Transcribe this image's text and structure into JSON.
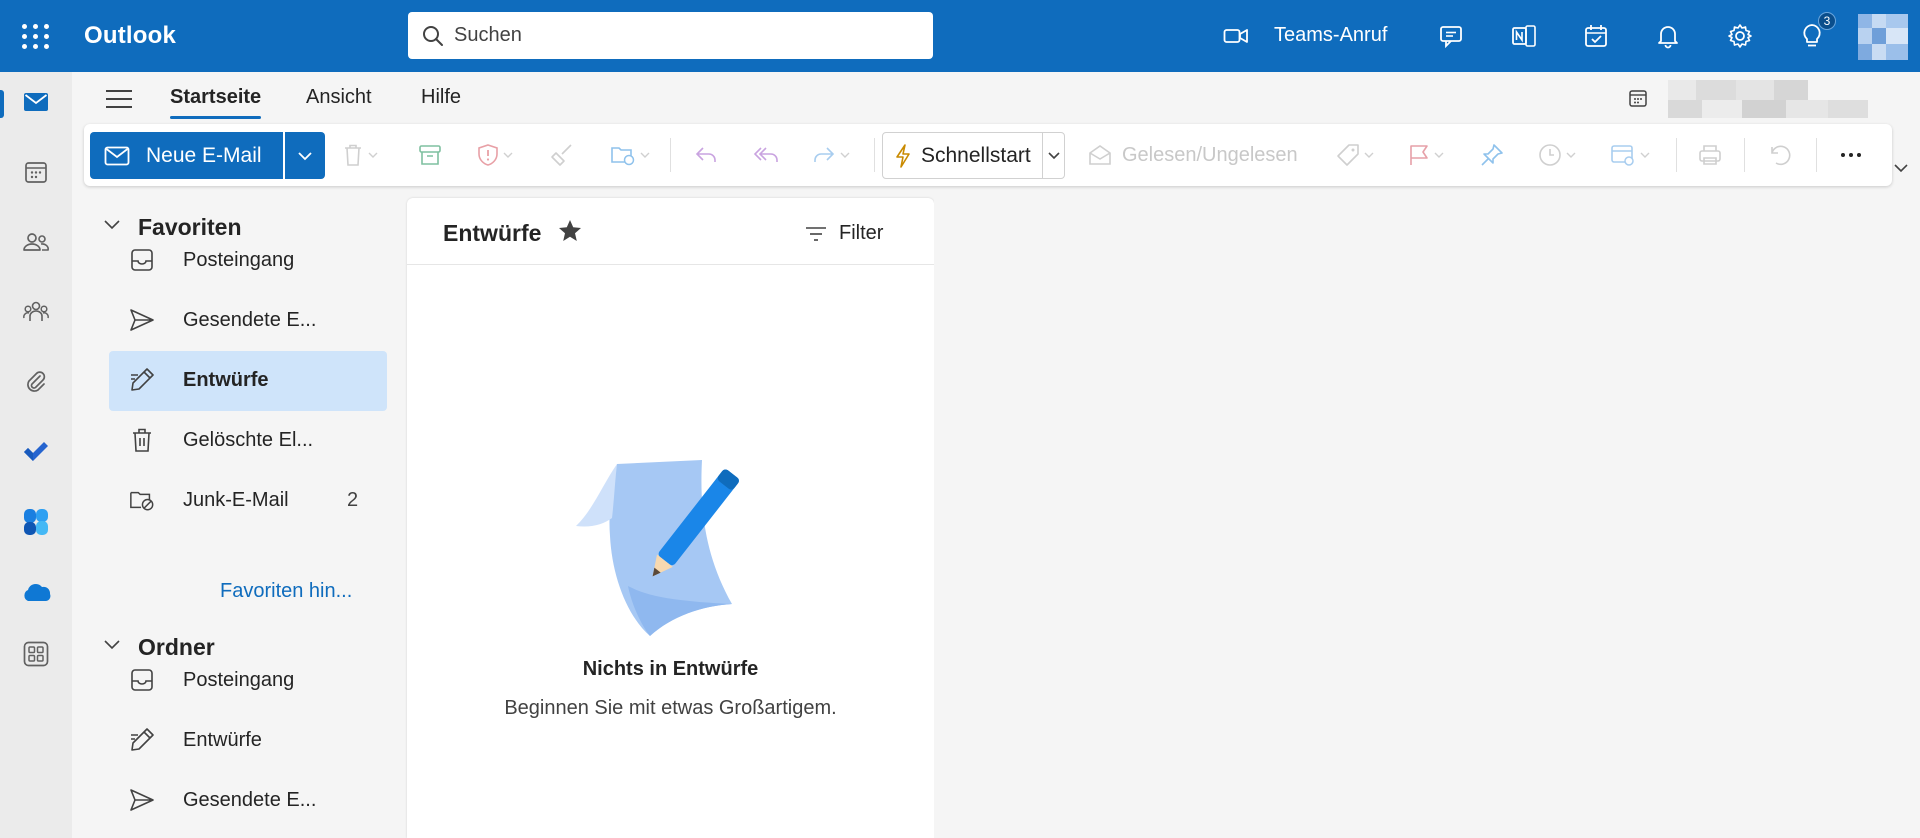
{
  "topbar": {
    "app_name": "Outlook",
    "search_placeholder": "Suchen",
    "teams_call_label": "Teams-Anruf",
    "tips_badge": "3",
    "colors": {
      "brand": "#0f6cbd",
      "selected": "#cfe4fa"
    }
  },
  "ribbon": {
    "tabs": [
      {
        "label": "Startseite",
        "active": true
      },
      {
        "label": "Ansicht",
        "active": false
      },
      {
        "label": "Hilfe",
        "active": false
      }
    ]
  },
  "commands": {
    "new_mail": "Neue E-Mail",
    "quick_steps": "Schnellstart",
    "read_unread": "Gelesen/Ungelesen"
  },
  "folders": {
    "favorites_header": "Favoriten",
    "favorites": [
      {
        "label": "Posteingang",
        "icon": "inbox-icon"
      },
      {
        "label": "Gesendete E...",
        "icon": "send-icon"
      },
      {
        "label": "Entwürfe",
        "icon": "drafts-icon",
        "selected": true
      },
      {
        "label": "Gelöschte El...",
        "icon": "trash-icon"
      },
      {
        "label": "Junk-E-Mail",
        "icon": "junk-icon",
        "count": "2"
      }
    ],
    "add_favorite": "Favoriten hin...",
    "folders_header": "Ordner",
    "folders": [
      {
        "label": "Posteingang",
        "icon": "inbox-icon"
      },
      {
        "label": "Entwürfe",
        "icon": "drafts-icon"
      },
      {
        "label": "Gesendete E...",
        "icon": "send-icon"
      }
    ]
  },
  "message_list": {
    "title": "Entwürfe",
    "filter_label": "Filter",
    "empty_title": "Nichts in Entwürfe",
    "empty_subtitle": "Beginnen Sie mit etwas Großartigem."
  }
}
